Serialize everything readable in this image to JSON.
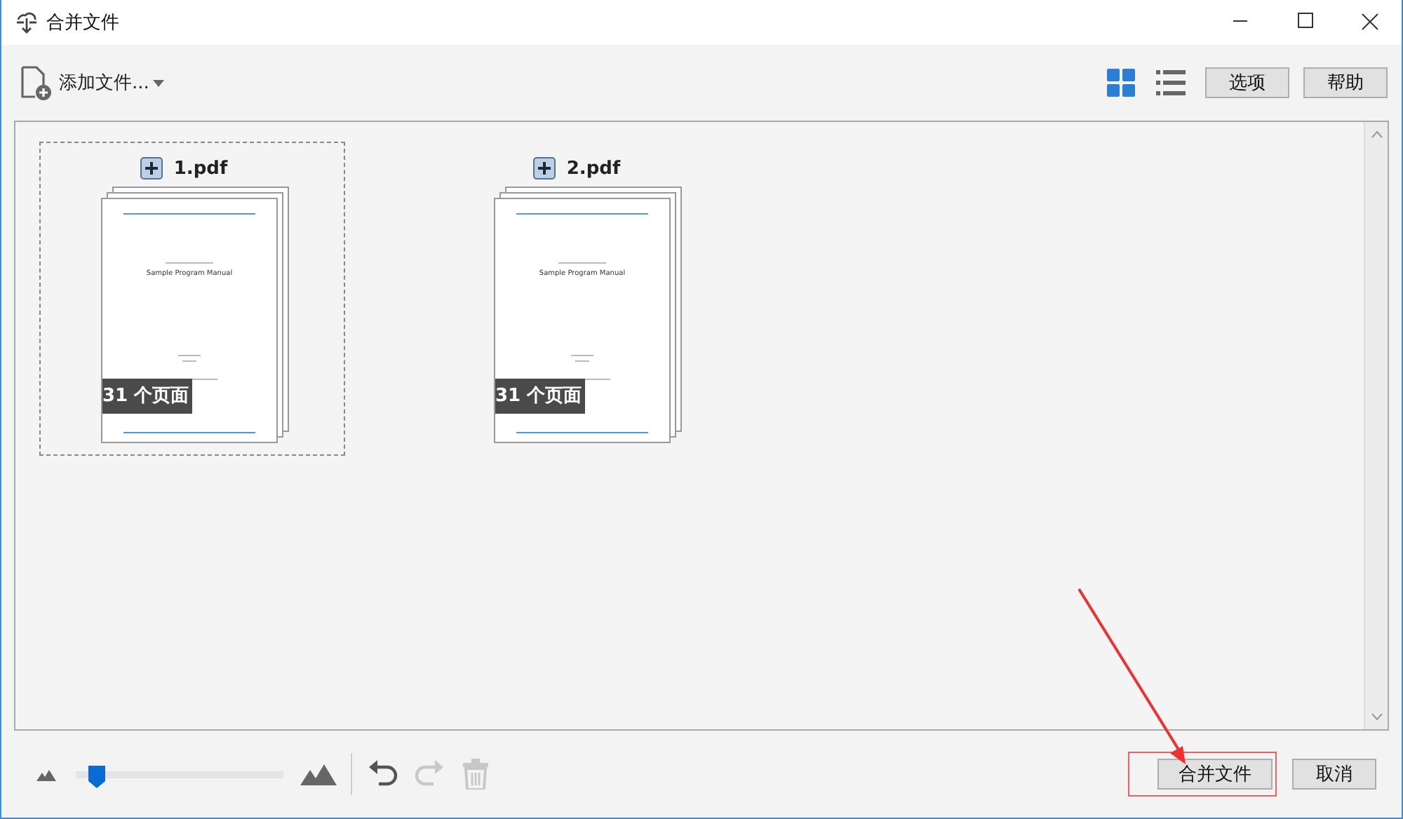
{
  "window": {
    "title": "合并文件"
  },
  "toolbar": {
    "add_button": "添加文件...",
    "views": [
      {
        "kind": "grid",
        "selected": true
      },
      {
        "kind": "list",
        "selected": false
      }
    ],
    "buttons": [
      "选项",
      "帮助"
    ]
  },
  "files": [
    {
      "name": "1.pdf",
      "selected": true,
      "page_badge": "31 个页面",
      "doc_title": "Sample Program Manual"
    },
    {
      "name": "2.pdf",
      "selected": false,
      "page_badge": "31 个页面",
      "doc_title": "Sample Program Manual"
    }
  ],
  "zoom": {
    "level": 0.1
  },
  "edit_tools": [
    {
      "kind": "undo",
      "disabled": false
    },
    {
      "kind": "redo",
      "disabled": true
    },
    {
      "kind": "delete",
      "disabled": true
    }
  ],
  "actions": [
    {
      "label": "合并文件",
      "highlighted": true
    },
    {
      "label": "取消",
      "highlighted": false
    }
  ]
}
